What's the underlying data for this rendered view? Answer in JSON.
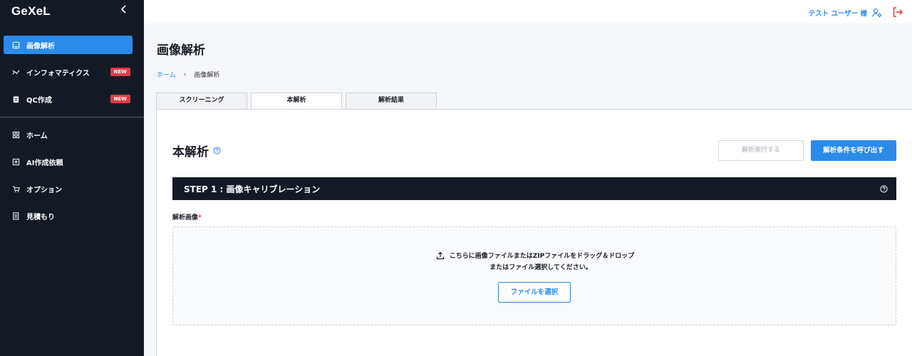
{
  "app": {
    "logo": "GeXeL"
  },
  "colors": {
    "accent": "#2c8ae8",
    "sidebar_bg": "#141a24",
    "badge": "#e03c44"
  },
  "sidebar": {
    "items": [
      {
        "label": "画像解析",
        "icon": "image-icon",
        "active": true
      },
      {
        "label": "インフォマティクス",
        "icon": "chart-icon",
        "badge": "NEW"
      },
      {
        "label": "QC作成",
        "icon": "clipboard-icon",
        "badge": "NEW"
      },
      {
        "label": "ホーム",
        "icon": "grid-icon"
      },
      {
        "label": "AI作成依頼",
        "icon": "plus-square-icon"
      },
      {
        "label": "オプション",
        "icon": "cart-icon"
      },
      {
        "label": "見積もり",
        "icon": "document-icon"
      }
    ]
  },
  "topbar": {
    "user": "テスト ユーザー 様"
  },
  "page": {
    "title": "画像解析",
    "breadcrumb": {
      "home": "ホーム",
      "separator": "›",
      "current": "画像解析"
    },
    "tabs": [
      {
        "label": "スクリーニング"
      },
      {
        "label": "本解析",
        "active": true
      },
      {
        "label": "解析結果"
      }
    ]
  },
  "section": {
    "title": "本解析",
    "run_button": "解析実行する",
    "load_button": "解析条件を呼び出す",
    "step_title": "STEP 1 : 画像キャリブレーション",
    "field_label": "解析画像",
    "required_mark": "*",
    "drop_text_1": "こちらに画像ファイルまたはZIPファイルをドラッグ＆ドロップ",
    "drop_text_2": "またはファイル選択してください。",
    "select_button": "ファイルを選択"
  }
}
